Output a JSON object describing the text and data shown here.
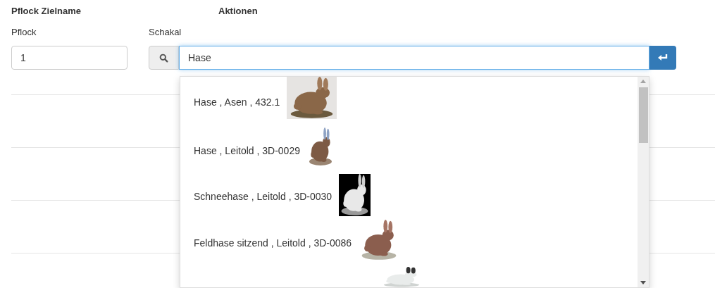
{
  "table": {
    "columns": [
      "Pflock Zielname",
      "Aktionen"
    ]
  },
  "pflock_field": {
    "label": "Pflock",
    "value": "1"
  },
  "target_field": {
    "label": "Schakal",
    "value": "Hase"
  },
  "suggestions": [
    {
      "text": "Hase , Asen , 432.1",
      "image": {
        "kind": "picture"
      }
    },
    {
      "text": "Hase , Leitold , 3D-0029",
      "image": {
        "kind": "picture"
      }
    },
    {
      "text": "Schneehase , Leitold , 3D-0030",
      "image": {
        "kind": "picture"
      }
    },
    {
      "text": "Feldhase sitzend , Leitold , 3D-0086",
      "image": {
        "kind": "picture"
      }
    },
    {
      "image": {
        "kind": "picture"
      }
    }
  ]
}
